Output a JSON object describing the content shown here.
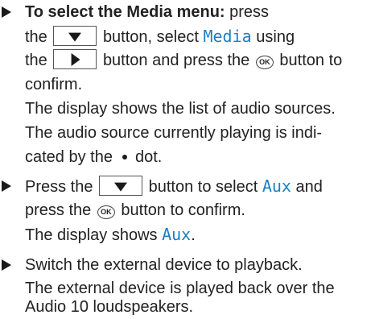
{
  "step1": {
    "heading": "To select the Media menu:",
    "line1_after": "press",
    "line2_before": "the",
    "line2_mid": "button, select",
    "line2_menu": "Media",
    "line2_after": "using",
    "line3_before": "the",
    "line3_mid": "button and press the",
    "line3_after": "button to",
    "line4": "confirm.",
    "line5": "The display shows the list of audio sources.",
    "line6": "The audio source currently playing is indi-",
    "line7_before": "cated by the",
    "line7_after": "dot."
  },
  "step2": {
    "line1_before": "Press the",
    "line1_mid": "button to select",
    "line1_option": "Aux",
    "line1_after": "and",
    "line2_before": "press the",
    "line2_after": "button to confirm.",
    "line3_before": "The display shows",
    "line3_option": "Aux",
    "line3_after": "."
  },
  "step3": {
    "line1": "Switch the external device to playback.",
    "line2": "The external device is played back over the",
    "line3": "Audio 10 loudspeakers."
  },
  "keys": {
    "down_icon": "down-arrow-key-icon",
    "right_icon": "right-arrow-key-icon",
    "ok_label": "OK"
  },
  "colors": {
    "display_text": "#1a7fc4",
    "body_text": "#222222"
  }
}
